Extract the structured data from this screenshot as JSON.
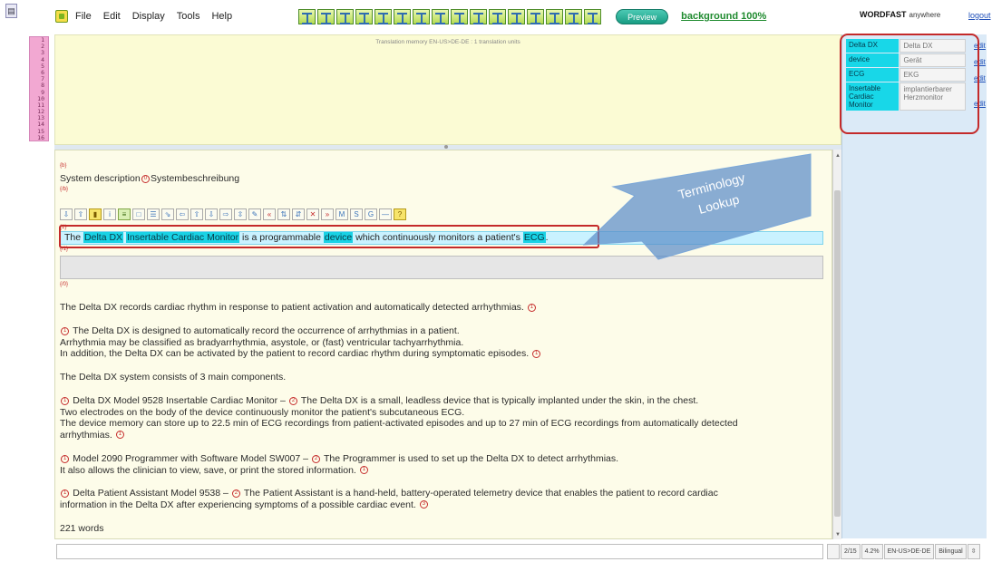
{
  "menu": {
    "items": [
      "File",
      "Edit",
      "Display",
      "Tools",
      "Help"
    ],
    "preview_label": "Preview",
    "background_label": "background 100%"
  },
  "brand": {
    "name": "WORDFAST",
    "suffix": "anywhere",
    "logout": "logout"
  },
  "segment_index": [
    "1",
    "2",
    "3",
    "4",
    "5",
    "6",
    "7",
    "8",
    "9",
    "10",
    "11",
    "12",
    "13",
    "14",
    "15",
    "16"
  ],
  "tm": {
    "header": "Translation memory EN-US>DE-DE : 1 translation units"
  },
  "terminology": {
    "entries": [
      {
        "source": "Delta DX",
        "target": "Delta DX"
      },
      {
        "source": "device",
        "target": "Gerät"
      },
      {
        "source": "ECG",
        "target": "EKG"
      },
      {
        "source": "Insertable Cardiac Monitor",
        "target": "implantierbarer Herzmonitor"
      }
    ],
    "edit_label": "edit"
  },
  "callout": {
    "text_line1": "Terminology",
    "text_line2": "Lookup"
  },
  "document": {
    "title_source": "System description",
    "title_target": "Systembeschreibung",
    "active_segment": {
      "part1": "The ",
      "term1": "Delta DX",
      "part2": " ",
      "term2": "Insertable Cardiac Monitor",
      "part3": " is a programmable ",
      "term3": "device",
      "part4": " which continuously monitors a patient's ",
      "term4": "ECG",
      "part5": "."
    },
    "paragraphs": [
      "The Delta DX records cardiac rhythm in response to patient activation and automatically detected arrhythmias.",
      "The Delta DX is designed to automatically record the occurrence of arrhythmias in a patient.",
      "Arrhythmia may be classified as bradyarrhythmia, asystole, or (fast) ventricular tachyarrhythmia.",
      "In addition, the Delta DX can be activated by the patient to record cardiac rhythm during symptomatic episodes.",
      "The Delta DX system consists of 3 main components.",
      "Delta DX Model 9528 Insertable Cardiac Monitor –",
      "The Delta DX is a small, leadless device that is typically implanted under the skin, in the chest.",
      "Two electrodes on the body of the device continuously monitor the patient's subcutaneous ECG.",
      "The device memory can store up to 22.5 min of ECG recordings from patient-activated episodes and up to 27 min of ECG recordings from automatically detected",
      "arrhythmias.",
      "Model 2090 Programmer with Software Model SW007 –",
      "The Programmer is used to set up the Delta DX to detect arrhythmias.",
      "It also allows the clinician to view, save, or print the stored information.",
      "Delta Patient Assistant Model 9538 –",
      "The Patient Assistant is a hand-held, battery-operated telemetry device that enables the patient to record cardiac",
      "information in the Delta DX after experiencing symptoms of a possible cardiac event."
    ],
    "word_count": "221 words"
  },
  "status": {
    "position": "2/15",
    "percent": "4.2%",
    "language_pair": "EN-US>DE-DE",
    "view_mode": "Bilingual"
  },
  "colors": {
    "term_highlight": "#19d2e5",
    "callout_red": "#c42a2a",
    "callout_blue": "#5b8ec9"
  }
}
